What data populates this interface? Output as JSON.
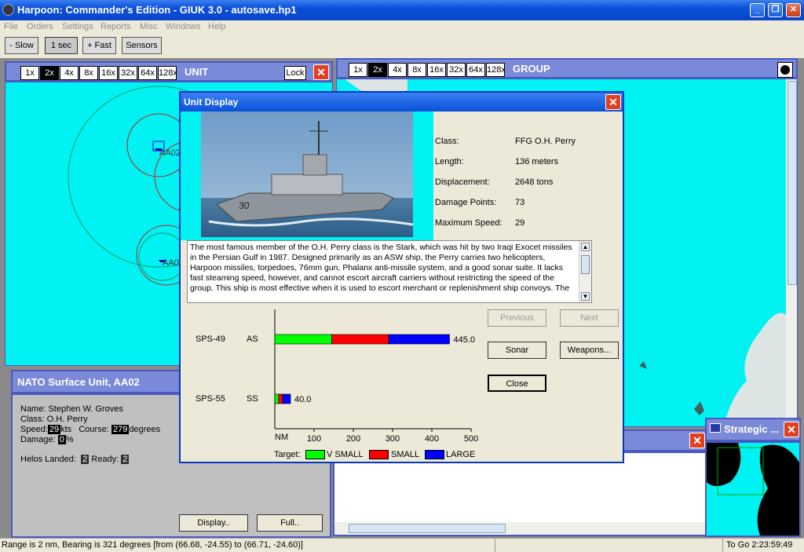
{
  "window": {
    "title": "Harpoon: Commander's Edition - GIUK 3.0 - autosave.hp1"
  },
  "menu": [
    "File",
    "Orders",
    "Settings",
    "Reports",
    "Misc",
    "Windows",
    "Help"
  ],
  "toolbar": {
    "slow": "- Slow",
    "step": "1 sec",
    "fast": "+ Fast",
    "sensors": "Sensors"
  },
  "zoom_levels": [
    "1x",
    "2x",
    "4x",
    "8x",
    "16x",
    "32x",
    "64x",
    "128x"
  ],
  "unit_panel": {
    "title": "UNIT",
    "lock": "Lock",
    "labels": [
      "AA02",
      "AA0"
    ]
  },
  "group_panel": {
    "title": "GROUP"
  },
  "nato": {
    "title": "NATO Surface Unit, AA02",
    "name": "Name: Stephen W. Groves",
    "class": "Class: O.H. Perry",
    "speed_label": "Speed:",
    "speed": "29",
    "kts": "kts",
    "course_label": "Course:",
    "course": "279",
    "degrees": "degrees",
    "damage_label": "Damage:",
    "damage": "0",
    "pct": "%",
    "helos_label": "Helos Landed:",
    "helos": "2",
    "ready_label": "Ready:",
    "ready": "2",
    "display_btn": "Display..",
    "full_btn": "Full.."
  },
  "strategic": {
    "title": "Strategic ..."
  },
  "unit_display": {
    "title": "Unit Display",
    "class_label": "Class:",
    "class_val": "FFG  O.H. Perry",
    "length_label": "Length:",
    "length_val": "136 meters",
    "disp_label": "Displacement:",
    "disp_val": "2648 tons",
    "dp_label": "Damage Points:",
    "dp_val": "73",
    "speed_label": "Maximum Speed:",
    "speed_val": "29",
    "description": "The most famous member of the O.H. Perry class is the Stark, which was hit by two Iraqi Exocet missiles in the Persian Gulf in 1987.  Designed primarily as an ASW ship, the Perry carries two helicopters, Harpoon missiles, torpedoes, 76mm gun, Phalanx anti-missile system, and a good sonar suite.  It lacks fast steaming speed, however, and cannot escort aircraft carriers without restricting the speed of the group.  This ship is most effective when it is used to escort merchant or replenishment ship convoys.  The",
    "hull_number": "30",
    "buttons": {
      "previous": "Previous",
      "next": "Next",
      "sonar": "Sonar",
      "weapons": "Weapons...",
      "close": "Close"
    },
    "sensors": [
      {
        "name": "SPS-49",
        "type": "AS",
        "vsmall": 145,
        "small": 290,
        "large": 445,
        "label": "445.0"
      },
      {
        "name": "SPS-55",
        "type": "SS",
        "vsmall": 10,
        "small": 20,
        "large": 40,
        "label": "40.0"
      }
    ],
    "axis": {
      "unit": "NM",
      "ticks": [
        "100",
        "200",
        "300",
        "400",
        "500"
      ],
      "max": 500
    },
    "legend": {
      "target": "Target:",
      "vsmall": "V SMALL",
      "small": "SMALL",
      "large": "LARGE"
    },
    "colors": {
      "vsmall": "#00ff00",
      "small": "#ff0000",
      "large": "#0000ff"
    }
  },
  "status": {
    "left": "Range is 2 nm, Bearing is 321 degrees [from (66.68, -24.55) to (66.71, -24.60)]",
    "right": "To Go 2:23:59:49"
  }
}
